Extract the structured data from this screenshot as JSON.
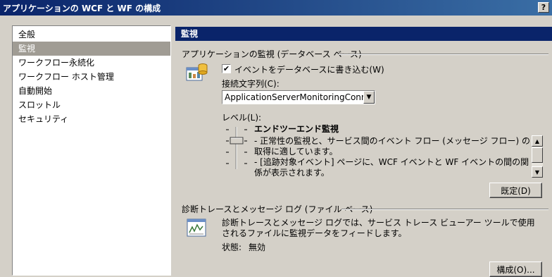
{
  "window": {
    "title": "アプリケーションの WCF と WF の構成",
    "help_label": "?"
  },
  "sidebar": {
    "items": [
      {
        "label": "全般",
        "active": false
      },
      {
        "label": "監視",
        "active": true
      },
      {
        "label": "ワークフロー永続化",
        "active": false
      },
      {
        "label": "ワークフロー ホスト管理",
        "active": false
      },
      {
        "label": "自動開始",
        "active": false
      },
      {
        "label": "スロットル",
        "active": false
      },
      {
        "label": "セキュリティ",
        "active": false
      }
    ]
  },
  "content": {
    "section_title": "監視",
    "monitoring_group": {
      "title": "アプリケーションの監視 (データベース ベース)",
      "checkbox_label": "イベントをデータベースに書き込む(W)",
      "checkbox_checked": true,
      "checkbox_mark": "✔",
      "connection_label": "接続文字列(C):",
      "connection_value": "ApplicationServerMonitoringConnection",
      "level_label": "レベル(L):",
      "level_name": "エンドツーエンド監視",
      "level_desc_1": "- 正常性の監視と、サービス間のイベント フロー (メッセージ フロー) の取得に適しています。",
      "level_desc_2": "- [追跡対象イベント] ページに、WCF イベントと WF イベントの間の関係が表示されます。",
      "default_button": "既定(D)"
    },
    "trace_group": {
      "title": "診断トレースとメッセージ ログ (ファイル ベース)",
      "description": "診断トレースとメッセージ ログでは、サービス トレース ビューアー ツールで使用されるファイルに監視データをフィードします。",
      "status_label": "状態:",
      "status_value": "無効",
      "configure_button": "構成(O)..."
    }
  }
}
